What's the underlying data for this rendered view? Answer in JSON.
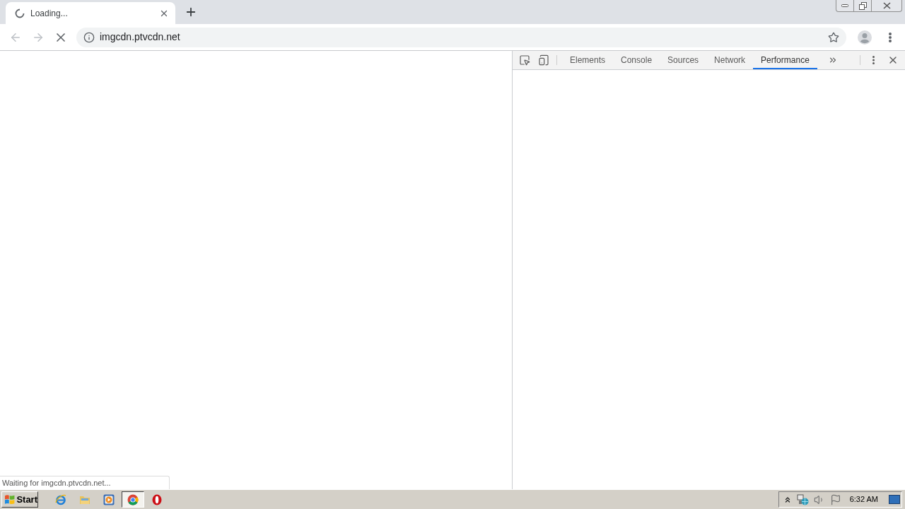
{
  "tabs": [
    {
      "title": "Loading...",
      "selected": true,
      "loading": true
    }
  ],
  "toolbar": {
    "loading": true,
    "address": "imgcdn.ptvcdn.net"
  },
  "page": {
    "status_bubble": "Waiting for imgcdn.ptvcdn.net..."
  },
  "devtools": {
    "tabs": [
      {
        "label": "Elements",
        "selected": false
      },
      {
        "label": "Console",
        "selected": false
      },
      {
        "label": "Sources",
        "selected": false
      },
      {
        "label": "Network",
        "selected": false
      },
      {
        "label": "Performance",
        "selected": true
      }
    ]
  },
  "taskbar": {
    "start": "Start",
    "apps": [
      {
        "kind": "ie",
        "selected": false
      },
      {
        "kind": "explorer",
        "selected": false
      },
      {
        "kind": "media",
        "selected": false
      },
      {
        "kind": "chrome",
        "selected": true
      },
      {
        "kind": "opera",
        "selected": false
      }
    ],
    "clock": "6:32 AM"
  }
}
